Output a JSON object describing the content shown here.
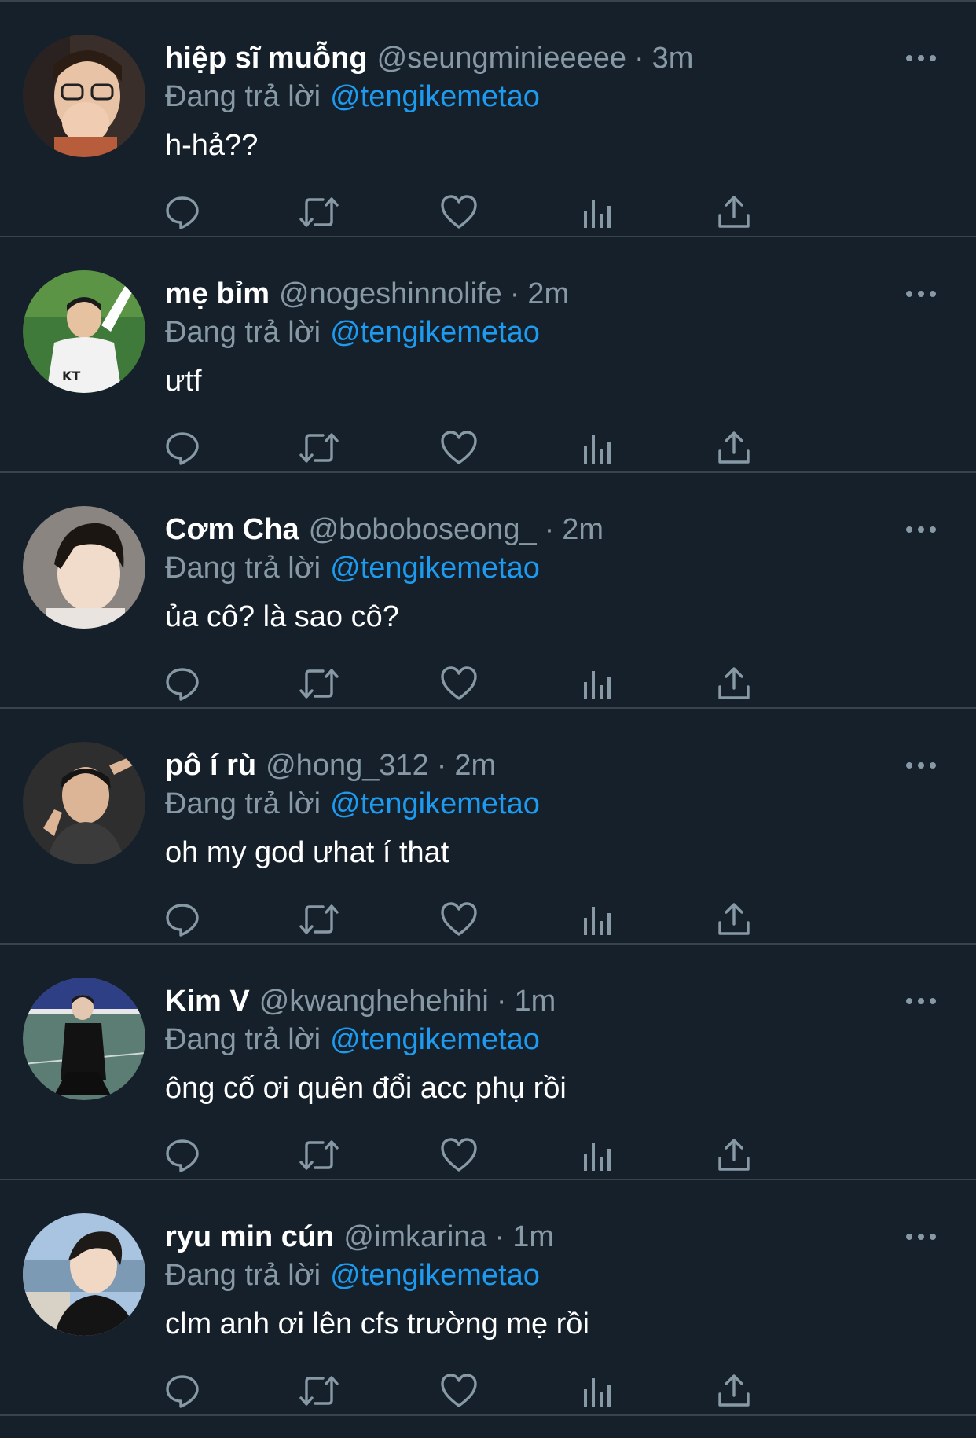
{
  "replying_label": "Đang trả lời",
  "colors": {
    "background": "#15202b",
    "divider": "#38444d",
    "secondary_text": "#8899a6",
    "link": "#1d9bf0"
  },
  "action_icons": [
    "reply-icon",
    "retweet-icon",
    "like-icon",
    "analytics-icon",
    "share-icon"
  ],
  "tweets": [
    {
      "name": "hiệp sĩ muỗng",
      "handle": "@seungminieeeee",
      "separator": "·",
      "time": "3m",
      "replying_to": "@tengikemetao",
      "text": "h-hả??"
    },
    {
      "name": "mẹ bỉm",
      "handle": "@nogeshinnolife",
      "separator": "·",
      "time": "2m",
      "replying_to": "@tengikemetao",
      "text": "ưtf"
    },
    {
      "name": "Cơm Cha",
      "handle": "@boboboseong_",
      "separator": "·",
      "time": "2m",
      "replying_to": "@tengikemetao",
      "text": "ủa cô? là sao cô?"
    },
    {
      "name": "pô í rù",
      "handle": "@hong_312",
      "separator": "·",
      "time": "2m",
      "replying_to": "@tengikemetao",
      "text": "oh my god ưhat í that"
    },
    {
      "name": "Kim V",
      "handle": "@kwanghehehihi",
      "separator": "·",
      "time": "1m",
      "replying_to": "@tengikemetao",
      "text": "ông cố ơi quên đổi acc phụ rồi"
    },
    {
      "name": "ryu min cún",
      "handle": "@imkarina",
      "separator": "·",
      "time": "1m",
      "replying_to": "@tengikemetao",
      "text": "clm anh ơi lên cfs trường mẹ rồi"
    }
  ]
}
